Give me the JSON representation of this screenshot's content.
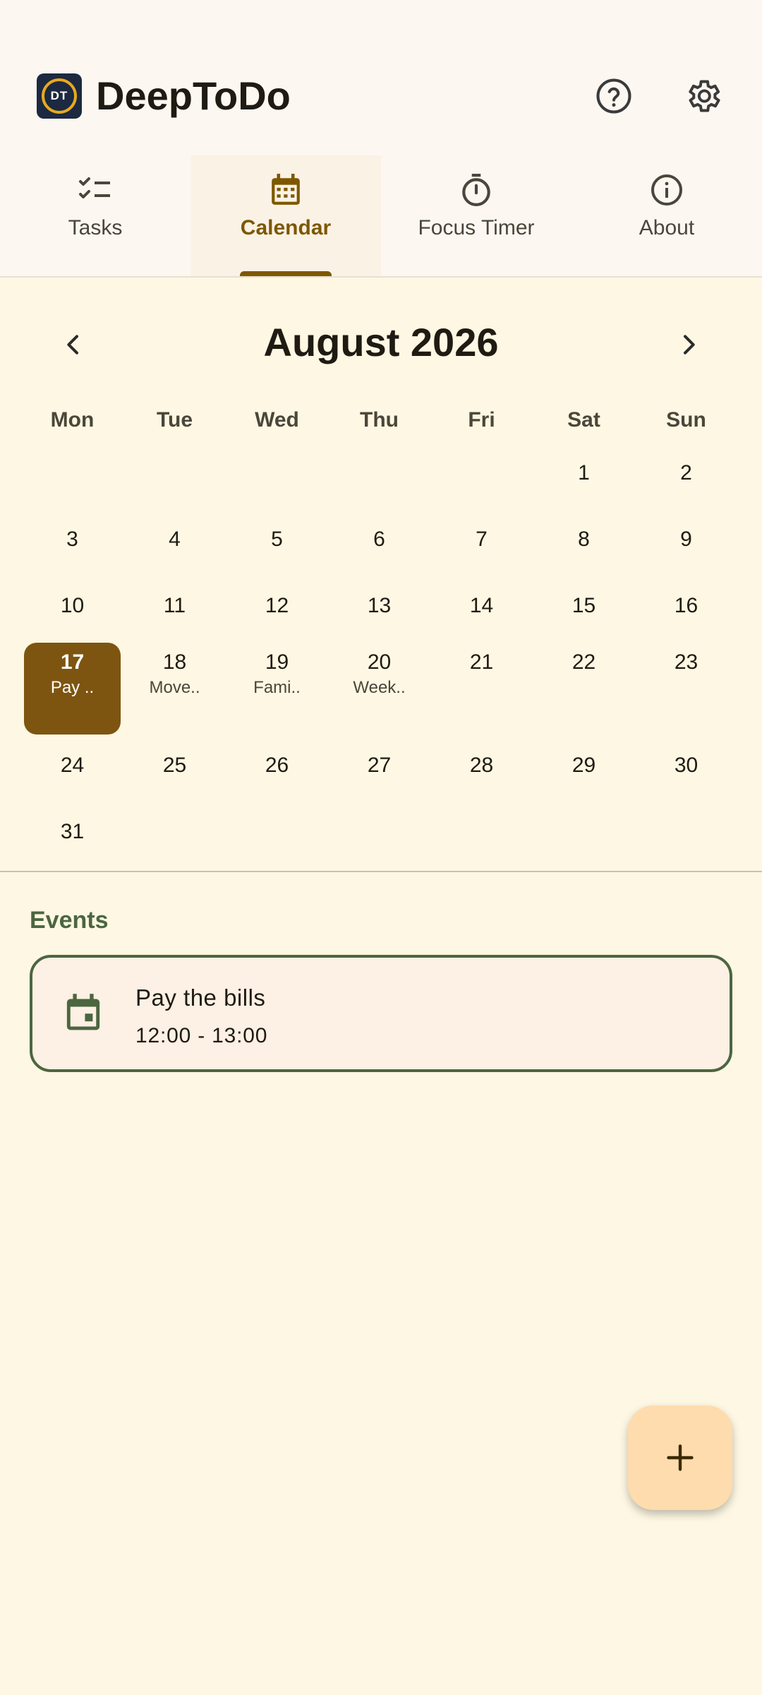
{
  "app": {
    "title": "DeepToDo",
    "logo_text": "DT"
  },
  "colors": {
    "accent": "#7d5800",
    "selected_day": "#7d5511",
    "events_accent": "#4c6640",
    "fab": "#ffdcae",
    "background": "#fdf7e3"
  },
  "header_icons": {
    "help": "help-circle-icon",
    "settings": "gear-icon"
  },
  "tabs": [
    {
      "label": "Tasks",
      "icon": "checklist-icon",
      "active": false
    },
    {
      "label": "Calendar",
      "icon": "calendar-icon",
      "active": true
    },
    {
      "label": "Focus Timer",
      "icon": "timer-icon",
      "active": false
    },
    {
      "label": "About",
      "icon": "info-icon",
      "active": false
    }
  ],
  "calendar": {
    "month_title": "August 2026",
    "weekdays": [
      "Mon",
      "Tue",
      "Wed",
      "Thu",
      "Fri",
      "Sat",
      "Sun"
    ],
    "weeks": [
      [
        null,
        null,
        null,
        null,
        null,
        {
          "day": "1"
        },
        {
          "day": "2"
        }
      ],
      [
        {
          "day": "3"
        },
        {
          "day": "4"
        },
        {
          "day": "5"
        },
        {
          "day": "6"
        },
        {
          "day": "7"
        },
        {
          "day": "8"
        },
        {
          "day": "9"
        }
      ],
      [
        {
          "day": "10"
        },
        {
          "day": "11"
        },
        {
          "day": "12"
        },
        {
          "day": "13"
        },
        {
          "day": "14"
        },
        {
          "day": "15"
        },
        {
          "day": "16"
        }
      ],
      [
        {
          "day": "17",
          "event": "Pay ..",
          "selected": true
        },
        {
          "day": "18",
          "event": "Move.."
        },
        {
          "day": "19",
          "event": "Fami.."
        },
        {
          "day": "20",
          "event": "Week.."
        },
        {
          "day": "21"
        },
        {
          "day": "22"
        },
        {
          "day": "23"
        }
      ],
      [
        {
          "day": "24"
        },
        {
          "day": "25"
        },
        {
          "day": "26"
        },
        {
          "day": "27"
        },
        {
          "day": "28"
        },
        {
          "day": "29"
        },
        {
          "day": "30"
        }
      ],
      [
        {
          "day": "31"
        },
        null,
        null,
        null,
        null,
        null,
        null
      ]
    ]
  },
  "events": {
    "heading": "Events",
    "items": [
      {
        "title": "Pay the bills",
        "time": "12:00 - 13:00",
        "icon": "event-calendar-icon"
      }
    ]
  },
  "fab": {
    "icon": "plus-icon"
  }
}
